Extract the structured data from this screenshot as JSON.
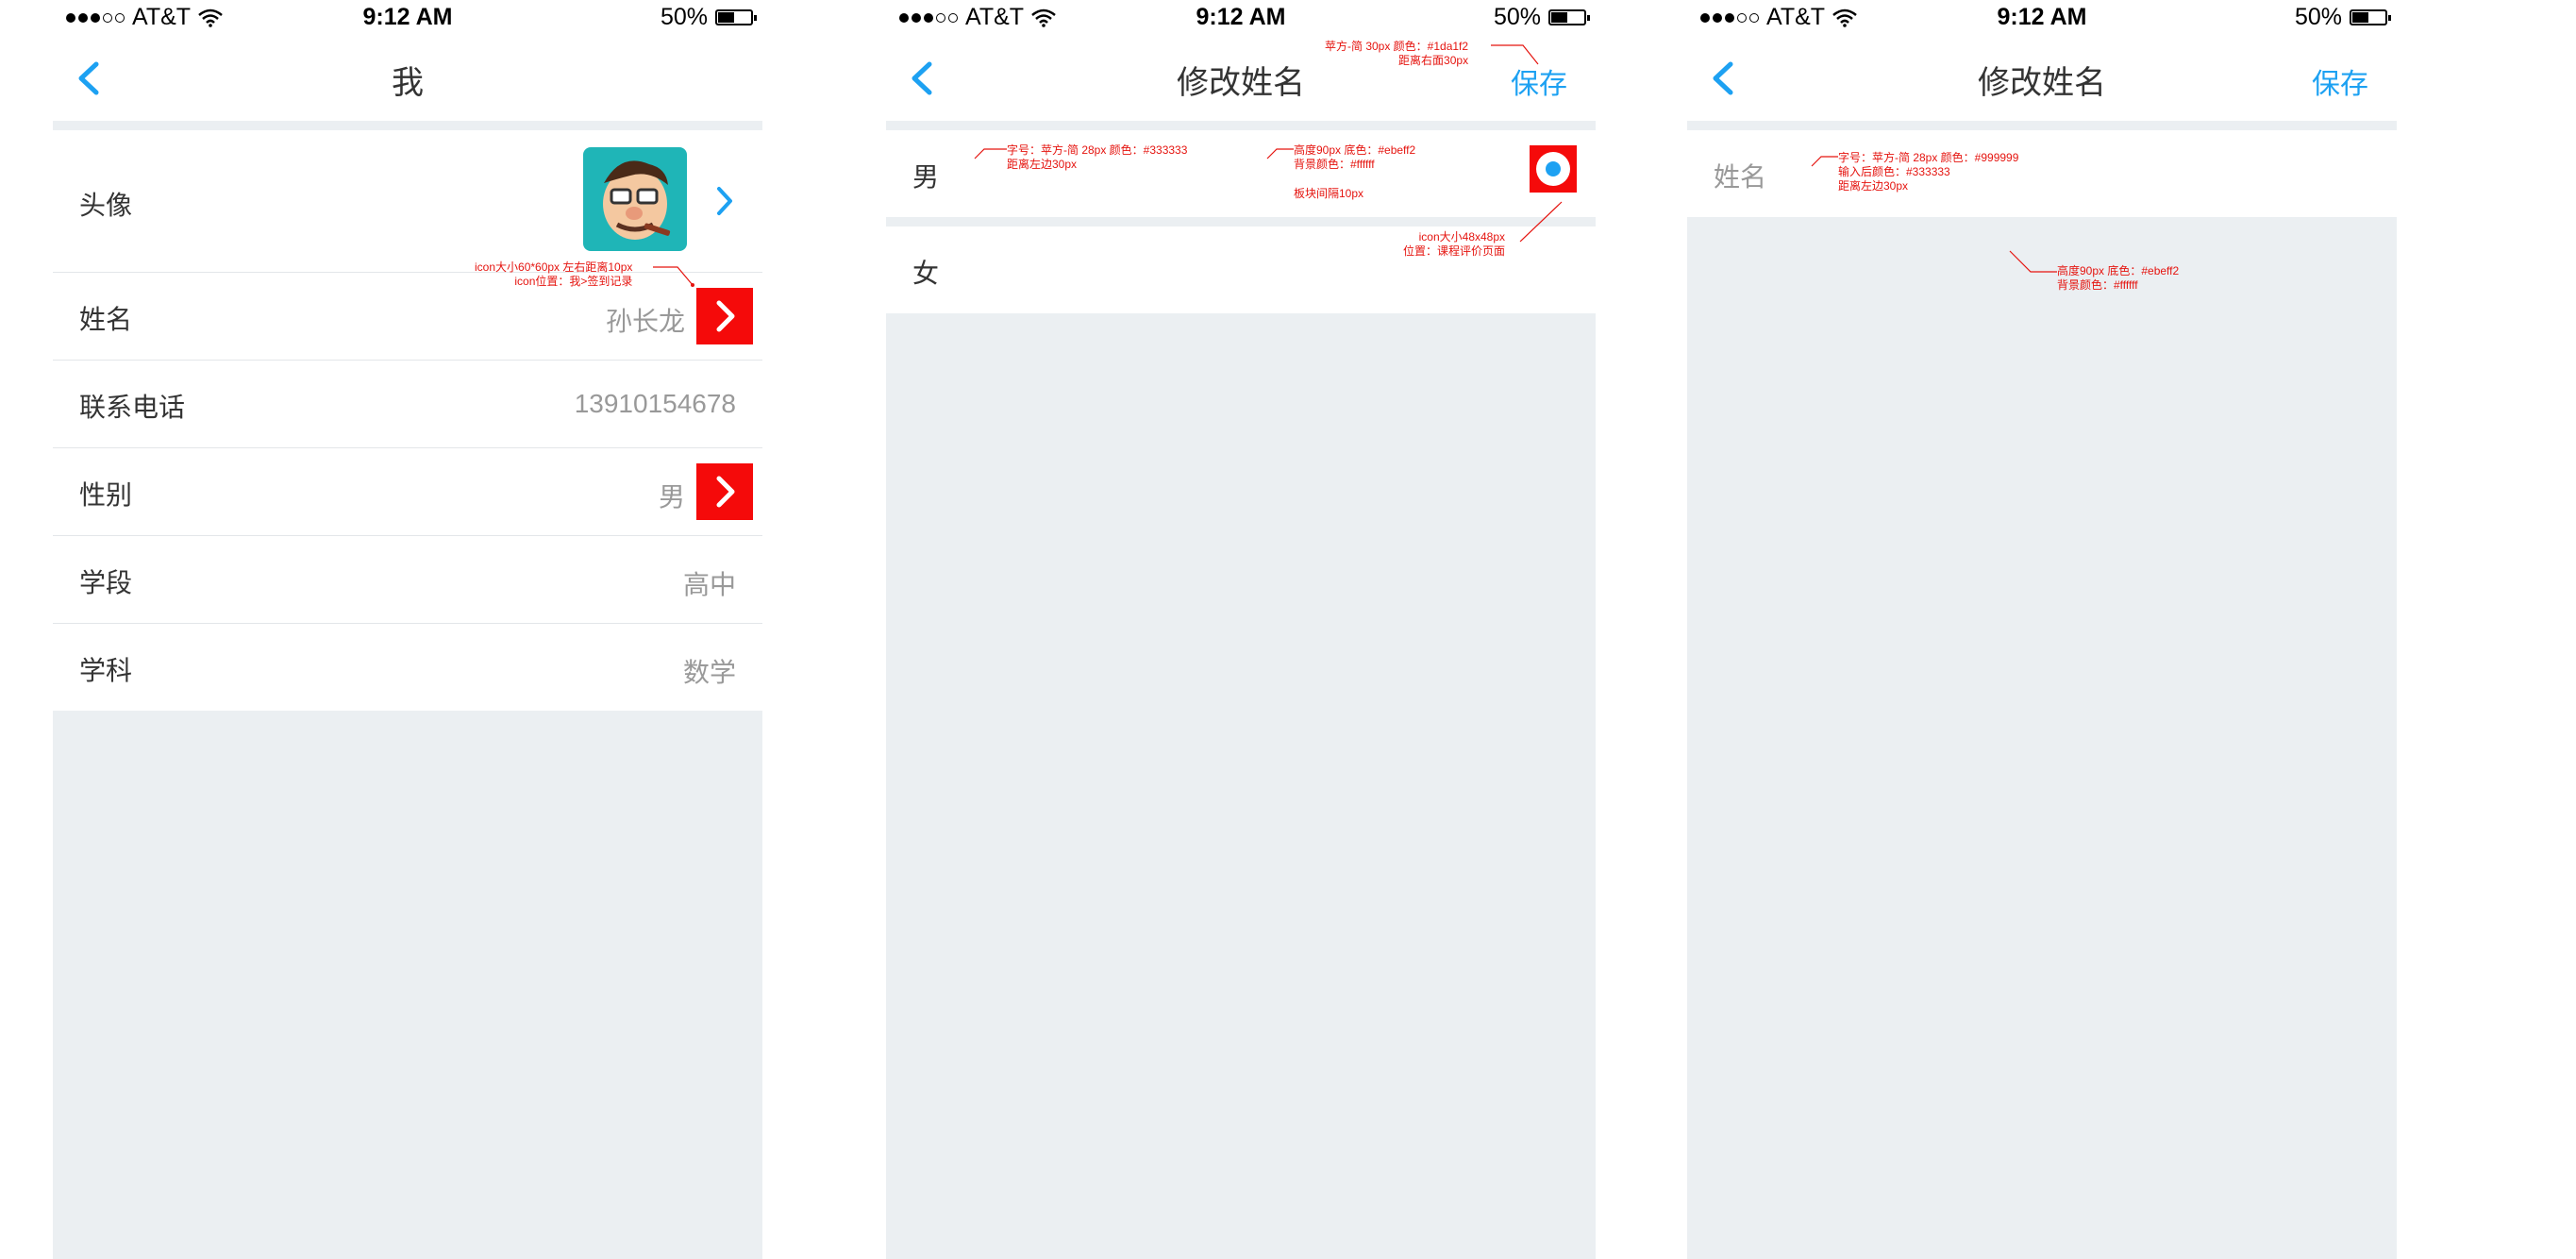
{
  "status_bar": {
    "carrier": "AT&T",
    "time": "9:12 AM",
    "battery": "50%",
    "battery_level": 0.5
  },
  "colors": {
    "accent": "#1da1f2",
    "text": "#333333",
    "secondary": "#999999",
    "bg": "#ebeff2",
    "annotation": "#e5140f",
    "highlight": "#f50a0a"
  },
  "screen1": {
    "title": "我",
    "rows": [
      {
        "label": "头像"
      },
      {
        "label": "姓名",
        "value": "孙长龙"
      },
      {
        "label": "联系电话",
        "value": "13910154678"
      },
      {
        "label": "性别",
        "value": "男"
      },
      {
        "label": "学段",
        "value": "高中"
      },
      {
        "label": "学科",
        "value": "数学"
      }
    ],
    "annotation": [
      "icon大小60*60px  左右距离10px",
      "icon位置：我>签到记录"
    ]
  },
  "screen2": {
    "title": "修改姓名",
    "save": "保存",
    "options": [
      {
        "label": "男"
      },
      {
        "label": "女"
      }
    ],
    "annotations": {
      "save": [
        "苹方-简 30px  颜色：#1da1f2",
        "距离右面30px"
      ],
      "font": [
        "字号：苹方-简 28px   颜色：#333333",
        "距离左边30px"
      ],
      "row": [
        "高度90px  底色：#ebeff2",
        "背景颜色：#ffffff"
      ],
      "gap": "板块间隔10px",
      "icon": [
        "icon大小48x48px",
        "位置：课程评价页面"
      ]
    }
  },
  "screen3": {
    "title": "修改姓名",
    "save": "保存",
    "placeholder": "姓名",
    "annotations": {
      "font": [
        "字号：苹方-简 28px   颜色：#999999",
        "输入后颜色：#333333",
        "距离左边30px"
      ],
      "row": [
        "高度90px  底色：#ebeff2",
        "背景颜色：#ffffff"
      ]
    }
  }
}
